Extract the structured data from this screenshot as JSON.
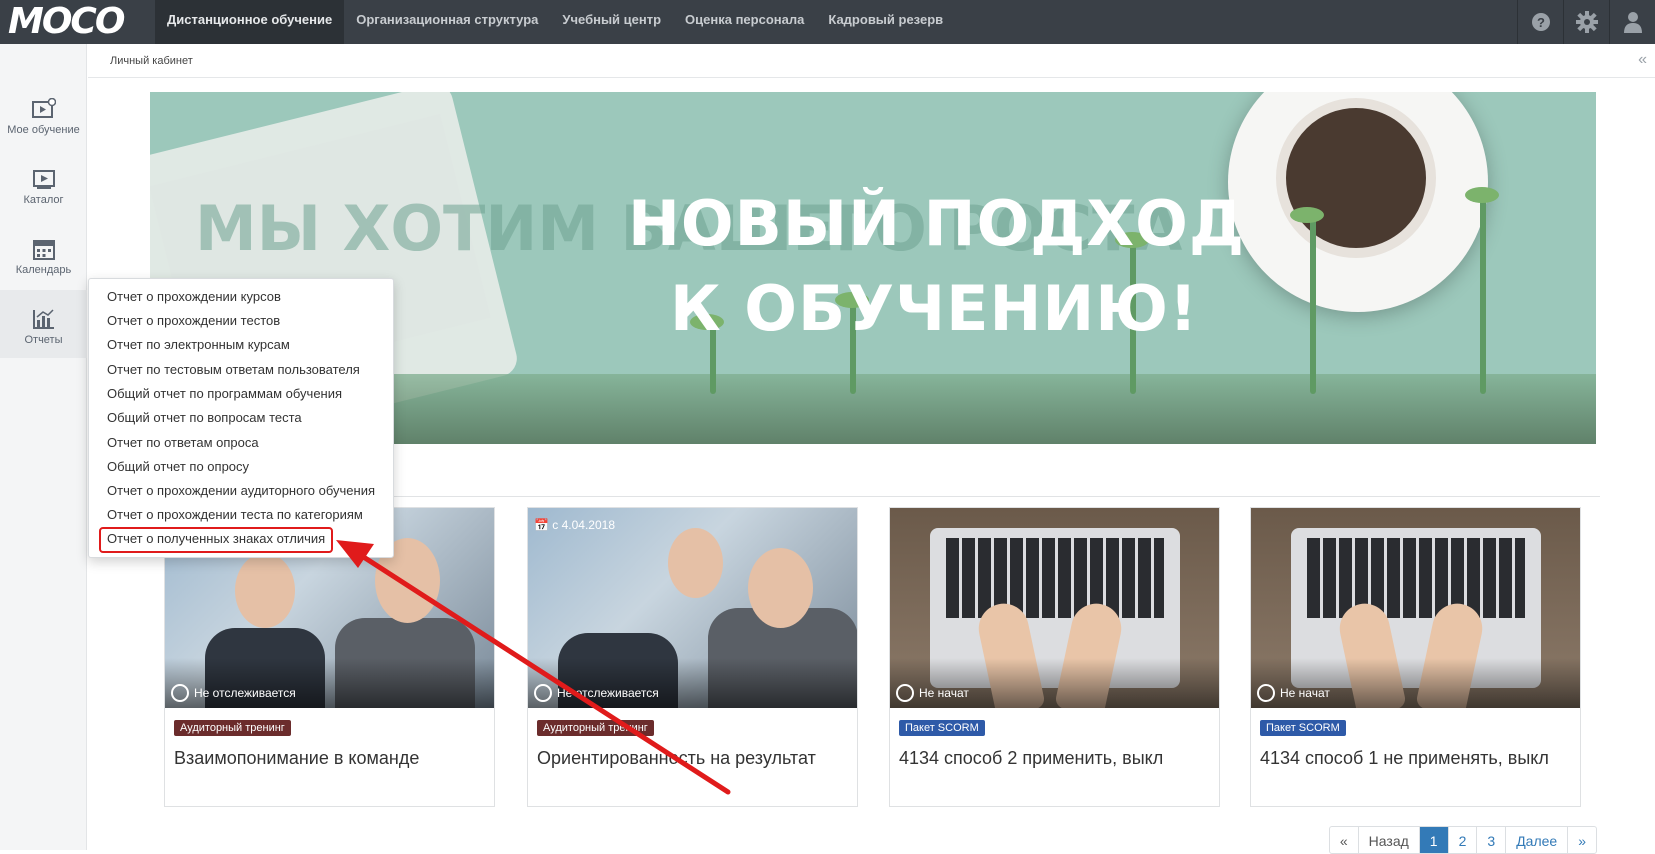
{
  "app": {
    "logo": "MOCO"
  },
  "nav": {
    "items": [
      {
        "label": "Дистанционное обучение",
        "active": true
      },
      {
        "label": "Организационная структура",
        "active": false
      },
      {
        "label": "Учебный центр",
        "active": false
      },
      {
        "label": "Оценка персонала",
        "active": false
      },
      {
        "label": "Кадровый резерв",
        "active": false
      }
    ],
    "icons": [
      "help-icon",
      "gear-icon",
      "user-icon"
    ]
  },
  "sidebar": {
    "items": [
      {
        "label": "Мое обучение",
        "icon": "my-learning-icon"
      },
      {
        "label": "Каталог",
        "icon": "catalog-icon"
      },
      {
        "label": "Календарь",
        "icon": "calendar-icon"
      },
      {
        "label": "Отчеты",
        "icon": "reports-icon",
        "active": true
      }
    ]
  },
  "breadcrumb": {
    "current": "Личный кабинет"
  },
  "banner": {
    "background_text": "МЫ ХОТИМ ВАШЕГО РОСТА",
    "title_line1": "НОВЫЙ ПОДХОД",
    "title_line2": "К ОБУЧЕНИЮ!"
  },
  "reports_menu": {
    "items": [
      "Отчет о прохождении курсов",
      "Отчет о прохождении тестов",
      "Отчет по электронным курсам",
      "Отчет по тестовым ответам пользователя",
      "Общий отчет по программам обучения",
      "Общий отчет по вопросам теста",
      "Отчет по ответам опроса",
      "Общий отчет по опросу",
      "Отчет о прохождении аудиторного обучения",
      "Отчет о прохождении теста по категориям",
      "Отчет о полученных знаках отличия"
    ],
    "highlighted_index": 10
  },
  "courses": [
    {
      "status": "Не отслеживается",
      "date": "",
      "tag": "Аудиторный тренинг",
      "tag_type": "aud",
      "title": "Взаимопонимание в команде",
      "image": "office"
    },
    {
      "status": "Не отслеживается",
      "date": "с 4.04.2018",
      "tag": "Аудиторный тренинг",
      "tag_type": "aud",
      "title": "Ориентированность на результат",
      "image": "office"
    },
    {
      "status": "Не начат",
      "date": "",
      "tag": "Пакет SCORM",
      "tag_type": "scorm",
      "title": "4134 способ 2 применить, выкл",
      "image": "laptop"
    },
    {
      "status": "Не начат",
      "date": "",
      "tag": "Пакет SCORM",
      "tag_type": "scorm",
      "title": "4134 способ 1 не применять, выкл",
      "image": "laptop"
    }
  ],
  "pagination": {
    "first": "«",
    "prev": "Назад",
    "pages": [
      "1",
      "2",
      "3"
    ],
    "active": "1",
    "next": "Далее",
    "last": "»"
  },
  "colors": {
    "topbar": "#3a4047",
    "banner": "#9cc8bb",
    "tag_aud": "#6b2c2c",
    "tag_scorm": "#2e5aa8",
    "highlight": "#e01b1b",
    "link": "#337ab7"
  }
}
